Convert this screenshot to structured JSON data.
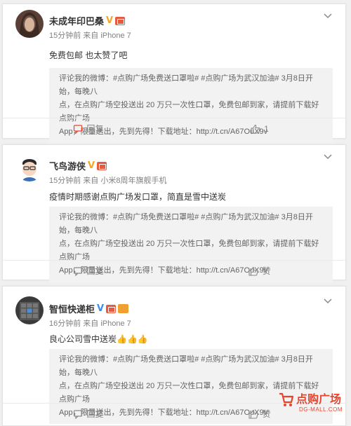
{
  "colors": {
    "accent": "#e8442c",
    "vip": "#f5a623",
    "meta": "#808080"
  },
  "posts": [
    {
      "username": "未成年印巴桑",
      "meta": "15分钟前 来自 iPhone 7",
      "content": "免费包邮 也太赞了吧",
      "quote_lines": [
        "评论我的微博：#点购广场免费送口罩啦# #点购广场为武汉加油#  3月8日开始，每晚八",
        "点，在点购广场空投送出 20 万只一次性口罩，免费包邮到家，请提前下载好点购广场",
        "App，限量送出，先到先得！下载地址：http://t.cn/A67OuX9v"
      ],
      "reply_label": "回复",
      "like_label": "1"
    },
    {
      "username": "飞鸟游侠",
      "meta": "15分钟前 来自 小米8周年旗舰手机",
      "content": "疫情时期感谢点购广场发口罩，简直是雪中送炭",
      "quote_lines": [
        "评论我的微博：#点购广场免费送口罩啦# #点购广场为武汉加油#  3月8日开始，每晚八",
        "点，在点购广场空投送出 20 万只一次性口罩，免费包邮到家，请提前下载好点购广场",
        "App，限量送出，先到先得！下载地址：http://t.cn/A67OuX9v"
      ],
      "reply_label": "回复",
      "like_label": "赞"
    },
    {
      "username": "智恒快递柜",
      "meta": "16分钟前 来自 iPhone 7",
      "content": "良心公司雪中送炭👍👍👍",
      "quote_lines": [
        "评论我的微博：#点购广场免费送口罩啦# #点购广场为武汉加油#  3月8日开始，每晚八",
        "点，在点购广场空投送出 20 万只一次性口罩，免费包邮到家，请提前下载好点购广场",
        "App，限量送出，先到先得！下载地址：http://t.cn/A67OuX9v"
      ],
      "reply_label": "回复",
      "like_label": "赞"
    }
  ],
  "watermark": {
    "title": "点购广场",
    "url": "DG-MALL.COM"
  },
  "icons": [
    "chevron-down-icon",
    "reply-icon",
    "thumbs-up-icon",
    "verified-v-icon",
    "cart-logo-icon"
  ]
}
